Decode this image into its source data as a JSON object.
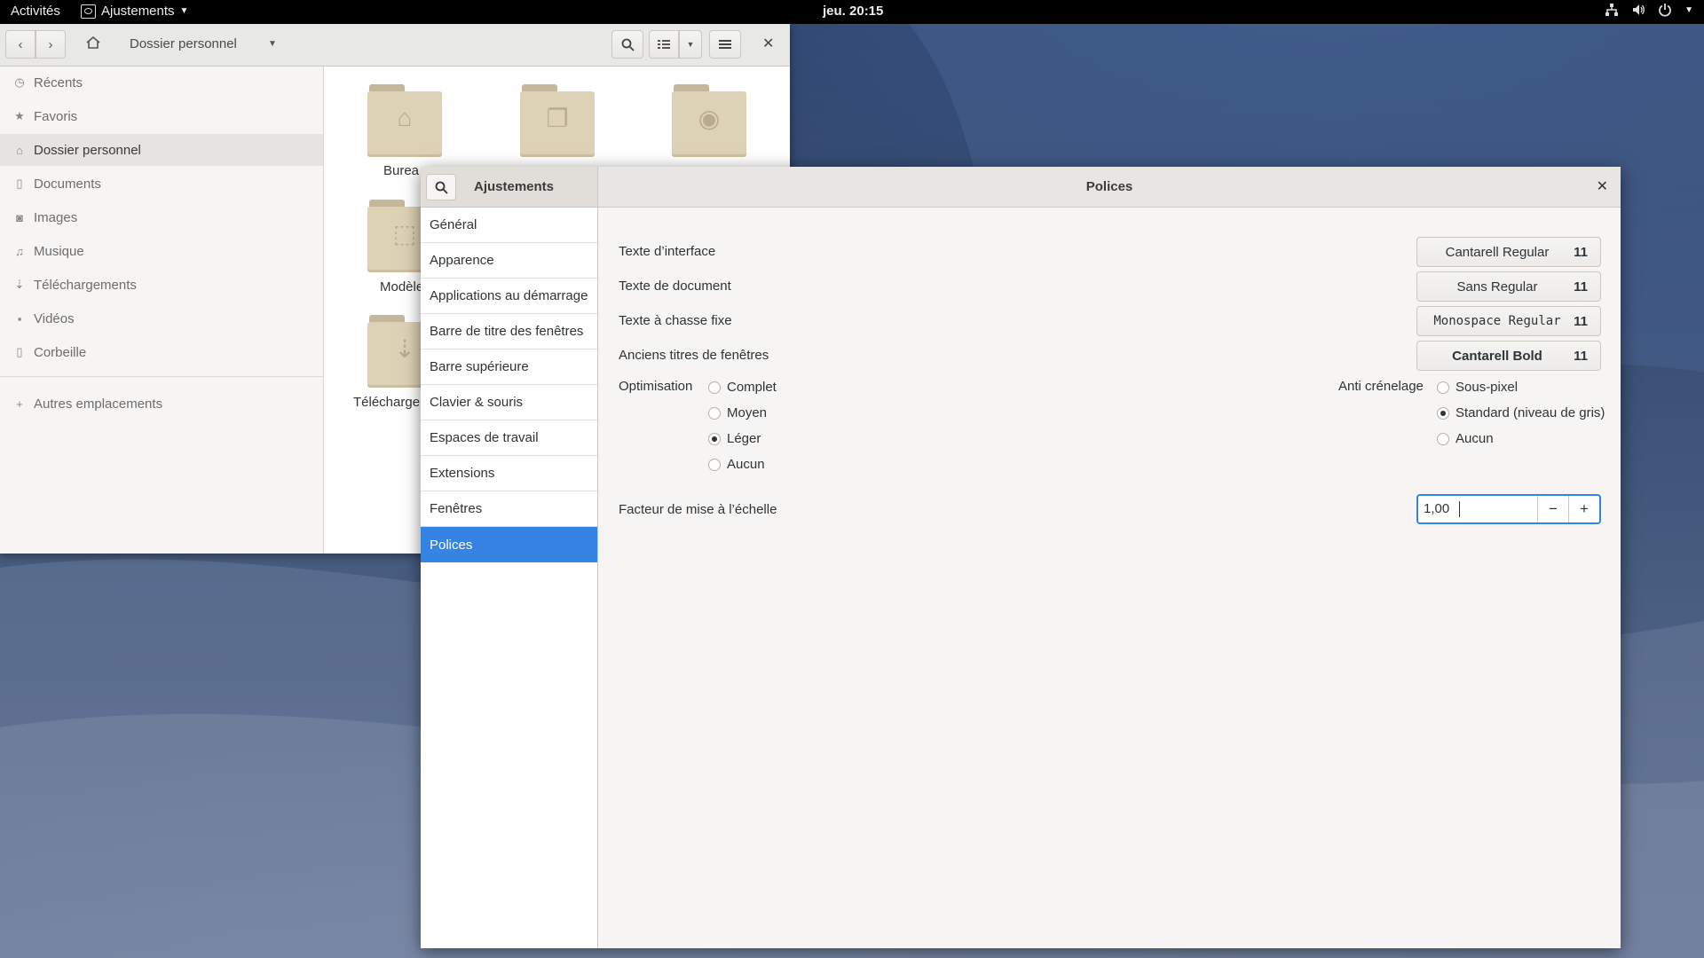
{
  "topbar": {
    "activities": "Activités",
    "app_menu_label": "Ajustements",
    "clock": "jeu. 20:15"
  },
  "file_manager": {
    "path": "Dossier personnel",
    "sidebar": [
      {
        "label": "Récents",
        "icon": "clock-icon"
      },
      {
        "label": "Favoris",
        "icon": "star-icon"
      },
      {
        "label": "Dossier personnel",
        "icon": "home-icon",
        "active": true
      },
      {
        "label": "Documents",
        "icon": "document-icon"
      },
      {
        "label": "Images",
        "icon": "camera-icon"
      },
      {
        "label": "Musique",
        "icon": "music-icon"
      },
      {
        "label": "Téléchargements",
        "icon": "download-icon"
      },
      {
        "label": "Vidéos",
        "icon": "video-icon"
      },
      {
        "label": "Corbeille",
        "icon": "trash-icon"
      }
    ],
    "other_locations": "Autres emplacements",
    "folders": [
      {
        "label": "Burea"
      },
      {
        "label": "Modèle"
      },
      {
        "label": "Télécharge"
      }
    ]
  },
  "tweaks": {
    "app_title": "Ajustements",
    "page_title": "Polices",
    "sidebar": [
      "Général",
      "Apparence",
      "Applications au démarrage",
      "Barre de titre des fenêtres",
      "Barre supérieure",
      "Clavier & souris",
      "Espaces de travail",
      "Extensions",
      "Fenêtres",
      "Polices"
    ],
    "active_item": "Polices",
    "fonts": [
      {
        "label": "Texte d’interface",
        "font": "Cantarell Regular",
        "size": "11"
      },
      {
        "label": "Texte de document",
        "font": "Sans Regular",
        "size": "11"
      },
      {
        "label": "Texte à chasse fixe",
        "font": "Monospace Regular",
        "size": "11"
      },
      {
        "label": "Anciens titres de fenêtres",
        "font": "Cantarell Bold",
        "size": "11"
      }
    ],
    "hinting": {
      "label": "Optimisation",
      "options": [
        "Complet",
        "Moyen",
        "Léger",
        "Aucun"
      ],
      "selected": "Léger"
    },
    "antialiasing": {
      "label": "Anti crénelage",
      "options": [
        "Sous-pixel",
        "Standard (niveau de gris)",
        "Aucun"
      ],
      "selected": "Standard (niveau de gris)"
    },
    "scaling": {
      "label": "Facteur de mise à l’échelle",
      "value": "1,00",
      "minus": "−",
      "plus": "+"
    }
  },
  "colors": {
    "accent": "#3584e4",
    "topbar": "#000000"
  }
}
